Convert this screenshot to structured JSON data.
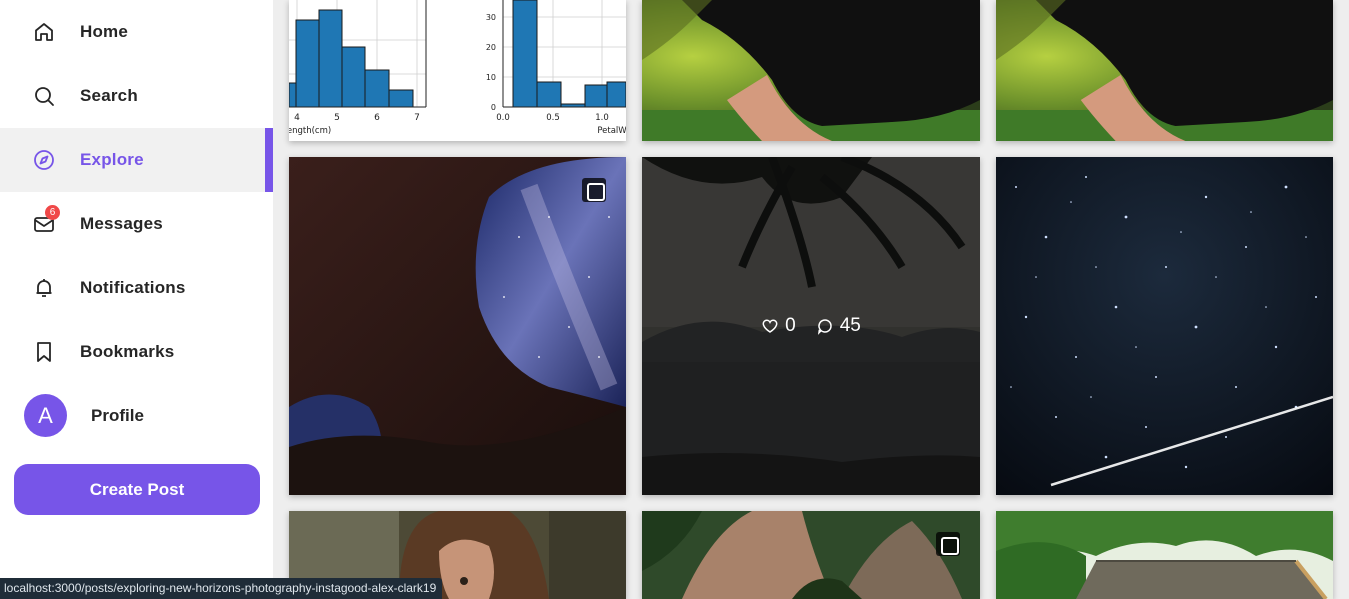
{
  "nav": {
    "items": [
      {
        "label": "Home",
        "icon": "home-icon"
      },
      {
        "label": "Search",
        "icon": "search-icon"
      },
      {
        "label": "Explore",
        "icon": "compass-icon",
        "active": true
      },
      {
        "label": "Messages",
        "icon": "mail-icon",
        "badge": "6"
      },
      {
        "label": "Notifications",
        "icon": "bell-icon"
      },
      {
        "label": "Bookmarks",
        "icon": "bookmark-icon"
      }
    ],
    "profile": {
      "initial": "A",
      "label": "Profile"
    },
    "create_post_label": "Create Post"
  },
  "colors": {
    "accent": "#7755e8",
    "badge": "#f04848"
  },
  "grid": {
    "hovered_post": {
      "likes": "0",
      "comments": "45"
    },
    "chart_tile": {
      "left_ticks": [
        "4",
        "5",
        "6",
        "7"
      ],
      "left_xlabel": "ength(cm)",
      "right_yticks": [
        "0",
        "10",
        "20",
        "30"
      ],
      "right_xticks": [
        "0.0",
        "0.5",
        "1.0"
      ],
      "right_xlabel": "PetalW"
    }
  },
  "status_bar": {
    "url": "localhost:3000/posts/exploring-new-horizons-photography-instagood-alex-clark19"
  }
}
